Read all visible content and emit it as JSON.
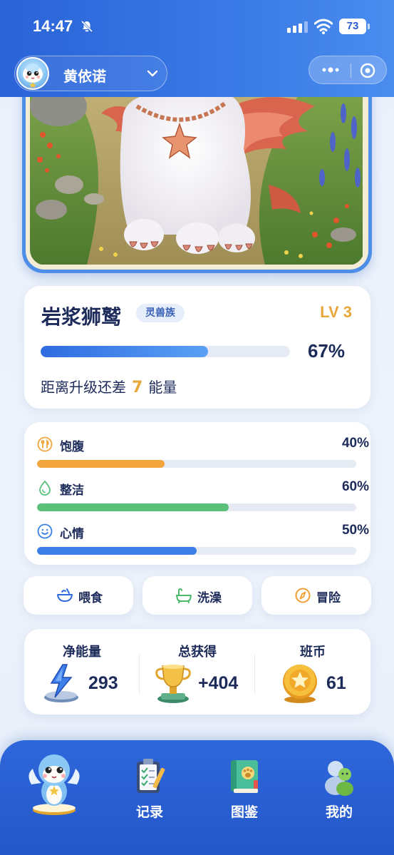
{
  "status_bar": {
    "time": "14:47",
    "battery": "73"
  },
  "header": {
    "user_name": "黄依诺"
  },
  "pet": {
    "name": "岩浆狮鹫",
    "tribe": "灵兽族",
    "level": "LV 3",
    "xp_percent_text": "67%",
    "xp_percent": 67,
    "upgrade_prefix": "距离升级还差",
    "upgrade_amount": "7",
    "upgrade_suffix": "能量"
  },
  "stats": [
    {
      "label": "饱腹",
      "value_text": "40%",
      "value": 40,
      "color": "#f2a53c",
      "icon": "fork-knife-icon"
    },
    {
      "label": "整洁",
      "value_text": "60%",
      "value": 60,
      "color": "#5cc07a",
      "icon": "droplet-icon"
    },
    {
      "label": "心情",
      "value_text": "50%",
      "value": 50,
      "color": "#3a7ee6",
      "icon": "smile-icon"
    }
  ],
  "actions": [
    {
      "label": "喂食",
      "icon": "bowl-icon",
      "color": "#2f6be0"
    },
    {
      "label": "洗澡",
      "icon": "bathtub-icon",
      "color": "#4cb86a"
    },
    {
      "label": "冒险",
      "icon": "compass-icon",
      "color": "#f0a032"
    }
  ],
  "resources": [
    {
      "title": "净能量",
      "value": "293",
      "icon": "lightning-crystal-icon"
    },
    {
      "title": "总获得",
      "value": "+404",
      "icon": "trophy-icon"
    },
    {
      "title": "班币",
      "value": "61",
      "icon": "gold-coin-icon"
    }
  ],
  "nav": [
    {
      "label": "",
      "icon": "pet-home-icon"
    },
    {
      "label": "记录",
      "icon": "clipboard-icon"
    },
    {
      "label": "图鉴",
      "icon": "paw-book-icon"
    },
    {
      "label": "我的",
      "icon": "profile-figures-icon"
    }
  ]
}
